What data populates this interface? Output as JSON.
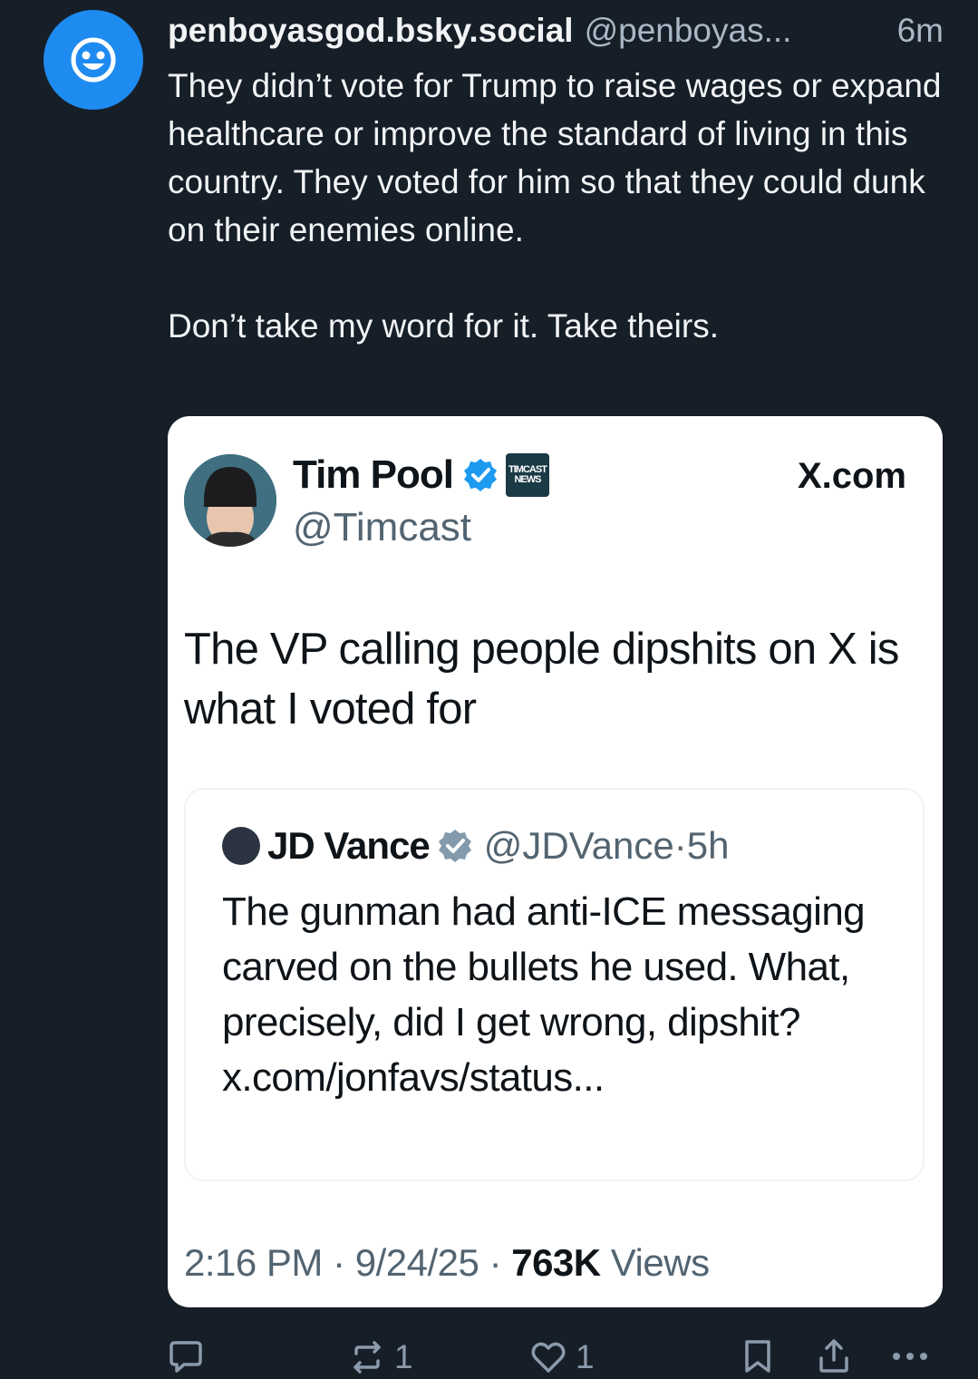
{
  "post": {
    "display_name": "penboyasgod.bsky.social",
    "handle": "@penboyas...",
    "time": "6m",
    "paragraph1": "They didn’t vote for Trump to raise wages or expand healthcare or improve the standard of living in this country. They voted for him so that they could dunk on their enemies online.",
    "paragraph2": "Don’t take my word for it. Take theirs."
  },
  "embed": {
    "author_name": "Tim Pool",
    "badge_text": "TIMCAST NEWS",
    "author_handle": "@Timcast",
    "site": "X.com",
    "text": "The VP calling people dipshits on X is what I voted for",
    "quote": {
      "author_name": "JD Vance",
      "author_handle": "@JDVance",
      "time": "5h",
      "text": "The gunman had anti-ICE messaging carved on the bullets he used. What, precisely, did I get wrong, dipshit? x.com/jonfavs/status..."
    },
    "time": "2:16 PM",
    "date": "9/24/25",
    "views_count": "763K",
    "views_label": "Views"
  },
  "actions": {
    "reply_icon": "reply-icon",
    "repost_count": "1",
    "like_count": "1",
    "bookmark_icon": "bookmark-icon",
    "share_icon": "share-icon",
    "more_icon": "more-icon"
  },
  "colors": {
    "background": "#161e27",
    "accent": "#1e8bf0",
    "muted": "#8b9bab"
  }
}
